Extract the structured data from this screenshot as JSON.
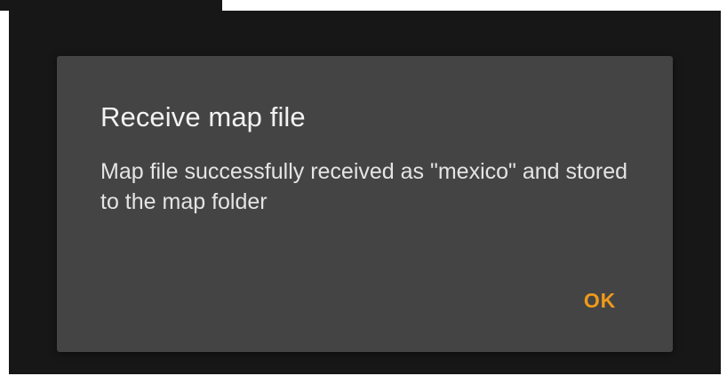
{
  "dialog": {
    "title": "Receive map file",
    "message": "Map file successfully received as \"mexico\" and stored to the map folder",
    "ok_label": "OK"
  },
  "colors": {
    "accent": "#ef9a1b",
    "dialog_background": "#444444",
    "screen_background": "#171717"
  }
}
